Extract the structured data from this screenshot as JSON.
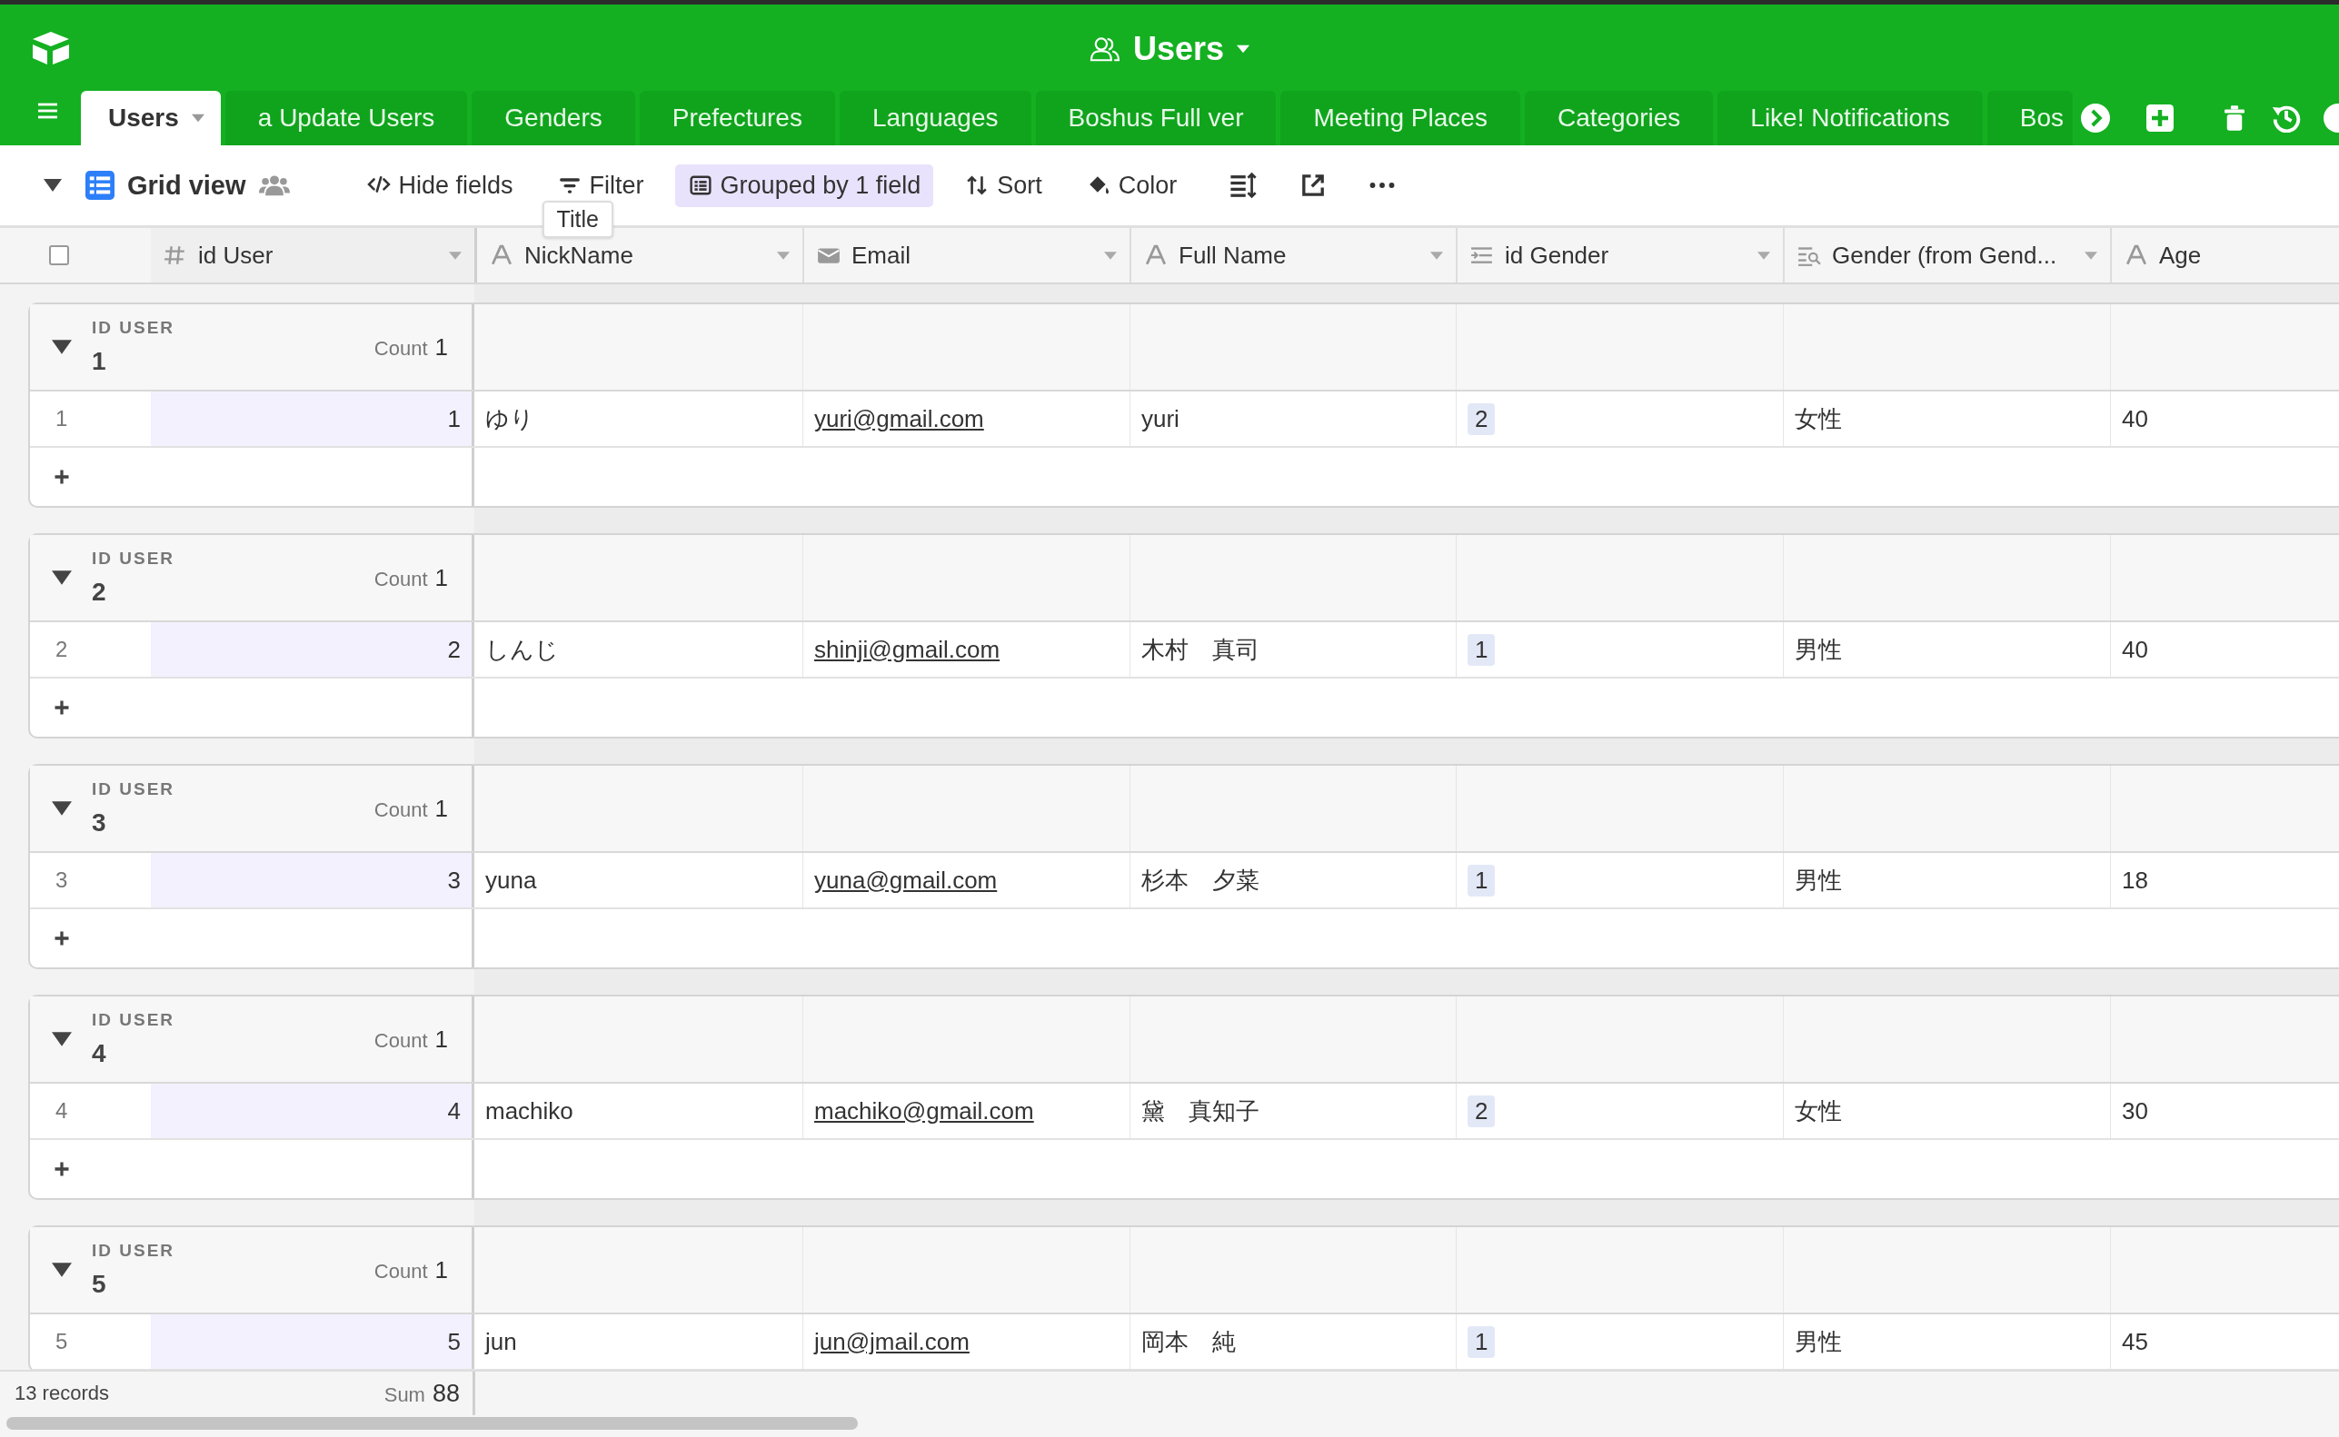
{
  "header": {
    "title": "Users"
  },
  "tabs": [
    {
      "label": "Users",
      "selected": true
    },
    {
      "label": "a Update Users",
      "selected": false
    },
    {
      "label": "Genders",
      "selected": false
    },
    {
      "label": "Prefectures",
      "selected": false
    },
    {
      "label": "Languages",
      "selected": false
    },
    {
      "label": "Boshus Full ver",
      "selected": false
    },
    {
      "label": "Meeting Places",
      "selected": false
    },
    {
      "label": "Categories",
      "selected": false
    },
    {
      "label": "Like! Notifications",
      "selected": false
    },
    {
      "label": "Bos",
      "selected": false
    }
  ],
  "toolbar": {
    "view_name": "Grid view",
    "buttons": [
      {
        "label": "Hide fields",
        "kind": "hide",
        "active": false
      },
      {
        "label": "Filter",
        "kind": "filter",
        "active": false
      },
      {
        "label": "Grouped by 1 field",
        "kind": "group",
        "active": true
      },
      {
        "label": "Sort",
        "kind": "sort",
        "active": false
      },
      {
        "label": "Color",
        "kind": "color",
        "active": false
      }
    ],
    "tooltip": "Title"
  },
  "select_all": {
    "checked": false
  },
  "columns": [
    {
      "name": "id User",
      "kind": "number"
    },
    {
      "name": "NickName",
      "kind": "text"
    },
    {
      "name": "Email",
      "kind": "email"
    },
    {
      "name": "Full Name",
      "kind": "text"
    },
    {
      "name": "id Gender",
      "kind": "link"
    },
    {
      "name": "Gender (from Gend...",
      "kind": "lookup"
    },
    {
      "name": "Age",
      "kind": "text"
    }
  ],
  "groups": [
    {
      "label": "ID USER",
      "value": "1",
      "count_label": "Count",
      "count": "1",
      "expanded": true,
      "records": [
        {
          "row": "1",
          "cells": [
            "1",
            "ゆり",
            "yuri@gmail.com",
            "yuri",
            "2",
            "女性",
            "40"
          ]
        }
      ]
    },
    {
      "label": "ID USER",
      "value": "2",
      "count_label": "Count",
      "count": "1",
      "expanded": true,
      "records": [
        {
          "row": "2",
          "cells": [
            "2",
            "しんじ",
            "shinji@gmail.com",
            "木村　真司",
            "1",
            "男性",
            "40"
          ]
        }
      ]
    },
    {
      "label": "ID USER",
      "value": "3",
      "count_label": "Count",
      "count": "1",
      "expanded": true,
      "records": [
        {
          "row": "3",
          "cells": [
            "3",
            "yuna",
            "yuna@gmail.com",
            "杉本　夕菜",
            "1",
            "男性",
            "18"
          ]
        }
      ]
    },
    {
      "label": "ID USER",
      "value": "4",
      "count_label": "Count",
      "count": "1",
      "expanded": true,
      "records": [
        {
          "row": "4",
          "cells": [
            "4",
            "machiko",
            "machiko@gmail.com",
            "黛　真知子",
            "2",
            "女性",
            "30"
          ]
        }
      ]
    },
    {
      "label": "ID USER",
      "value": "5",
      "count_label": "Count",
      "count": "1",
      "expanded": true,
      "records": [
        {
          "row": "5",
          "cells": [
            "5",
            "jun",
            "jun@jmail.com",
            "岡本　純",
            "1",
            "男性",
            "45"
          ]
        }
      ]
    }
  ],
  "footer": {
    "records": "13 records",
    "summary_label": "Sum",
    "summary_value": "88"
  }
}
